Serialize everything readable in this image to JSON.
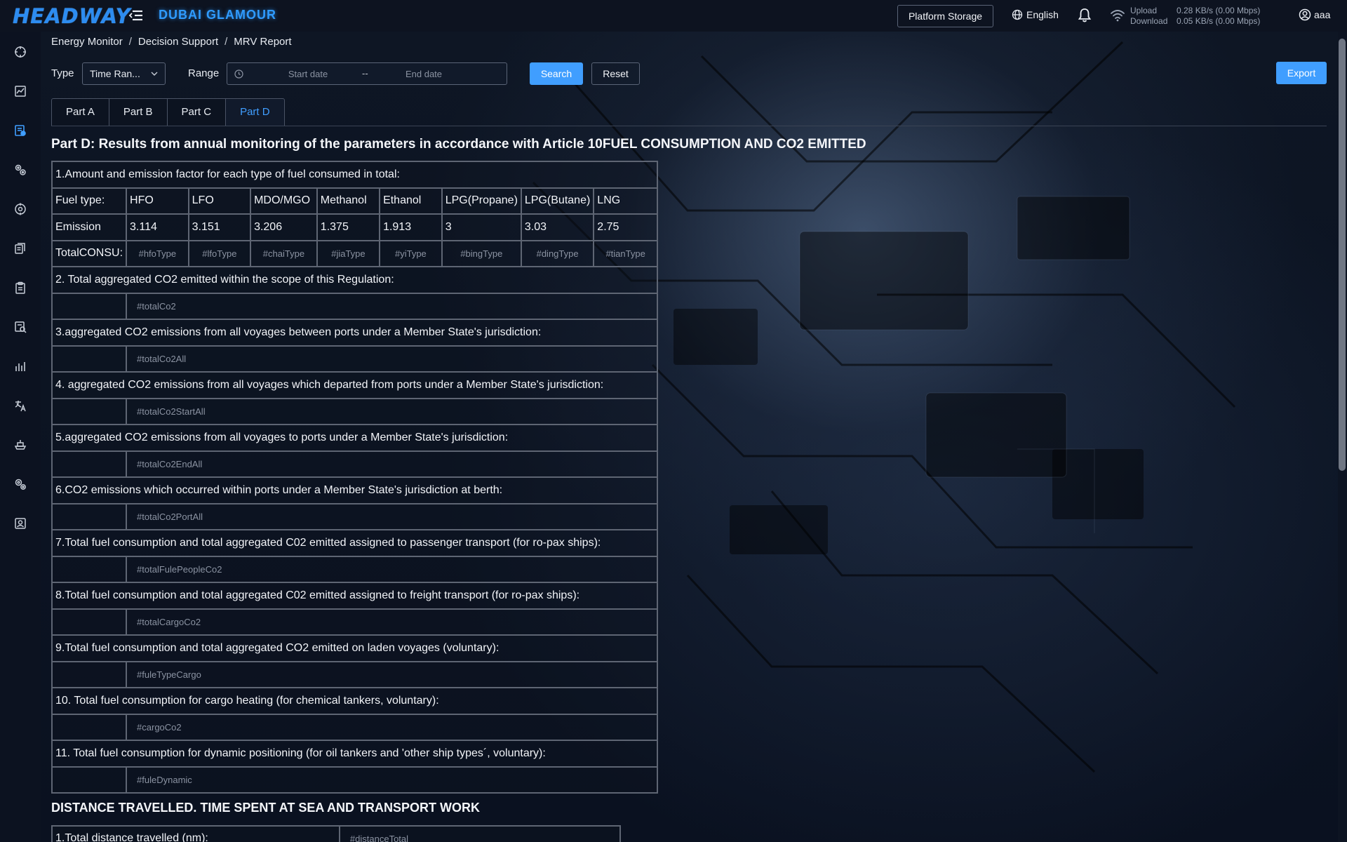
{
  "header": {
    "logo_text": "HEADWAY",
    "ship_name": "DUBAI GLAMOUR",
    "storage_label": "Platform Storage",
    "language": "English",
    "network": {
      "upload_label": "Upload",
      "download_label": "Download",
      "upload_value": "0.28 KB/s (0.00 Mbps)",
      "download_value": "0.05 KB/s (0.00 Mbps)"
    },
    "user_name": "aaa"
  },
  "sidebar": {
    "items": [
      {
        "icon": "crosshair-icon"
      },
      {
        "icon": "chart-icon"
      },
      {
        "icon": "report-icon",
        "active": true
      },
      {
        "icon": "gears-icon"
      },
      {
        "icon": "target-icon"
      },
      {
        "icon": "documents-icon"
      },
      {
        "icon": "clipboard-icon"
      },
      {
        "icon": "analysis-icon"
      },
      {
        "icon": "bar-chart-icon"
      },
      {
        "icon": "translate-icon"
      },
      {
        "icon": "ship-icon"
      },
      {
        "icon": "settings-icon"
      },
      {
        "icon": "user-card-icon"
      }
    ]
  },
  "breadcrumb": [
    "Energy Monitor",
    "Decision Support",
    "MRV Report"
  ],
  "breadcrumb_separator": "/",
  "filters": {
    "type_label": "Type",
    "type_value": "Time Ran...",
    "range_label": "Range",
    "start_placeholder": "Start date",
    "end_placeholder": "End date",
    "range_separator": "--",
    "search_label": "Search",
    "reset_label": "Reset",
    "export_label": "Export"
  },
  "tabs": [
    {
      "label": "Part A",
      "active": false
    },
    {
      "label": "Part B",
      "active": false
    },
    {
      "label": "Part C",
      "active": false
    },
    {
      "label": "Part D",
      "active": true
    }
  ],
  "part_title": "Part D: Results from annual monitoring of the parameters in accordance with Article 10FUEL CONSUMPTION AND CO2 EMITTED",
  "fuel_table": {
    "heading": "1.Amount and emission factor for each type of fuel consumed in total:",
    "fuel_type_label": "Fuel type:",
    "fuel_types": [
      "HFO",
      "LFO",
      "MDO/MGO",
      "Methanol",
      "Ethanol",
      "LPG(Propane)",
      "LPG(Butane)",
      "LNG"
    ],
    "emission_label": "Emission",
    "emission_values": [
      "3.114",
      "3.151",
      "3.206",
      "1.375",
      "1.913",
      "3",
      "3.03",
      "2.75"
    ],
    "total_label": "TotalCONSU:",
    "total_placeholders": [
      "#hfoType",
      "#lfoType",
      "#chaiType",
      "#jiaType",
      "#yiType",
      "#bingType",
      "#dingType",
      "#tianType"
    ]
  },
  "items": [
    {
      "label": "2. Total aggregated CO2 emitted within the scope of this Regulation:",
      "placeholder": "#totalCo2"
    },
    {
      "label": "3.aggregated CO2 emissions from all voyages between ports under a Member State's jurisdiction:",
      "placeholder": "#totalCo2All"
    },
    {
      "label": "4. aggregated CO2 emissions from all voyages which departed from ports under a Member State's jurisdiction:",
      "placeholder": "#totalCo2StartAll"
    },
    {
      "label": "5.aggregated CO2 emissions from all voyages to ports under a Member State's jurisdiction:",
      "placeholder": "#totalCo2EndAll"
    },
    {
      "label": "6.CO2 emissions which occurred within ports under a Member State's jurisdiction at berth:",
      "placeholder": "#totalCo2PortAll"
    },
    {
      "label": "7.Total fuel consumption and total aggregated C02 emitted assigned to passenger transport (for ro-pax ships):",
      "placeholder": "#totalFulePeopleCo2"
    },
    {
      "label": "8.Total fuel consumption and total aggregated C02 emitted assigned to freight transport (for ro-pax ships):",
      "placeholder": "#totalCargoCo2"
    },
    {
      "label": "9.Total fuel consumption and total aggregated CO2 emitted on laden voyages (voluntary):",
      "placeholder": "#fuleTypeCargo"
    },
    {
      "label": "10. Total fuel consumption for cargo heating (for chemical tankers, voluntary):",
      "placeholder": "#cargoCo2"
    },
    {
      "label": "11. Total fuel consumption for dynamic positioning (for oil tankers and 'other ship types´, voluntary):",
      "placeholder": "#fuleDynamic"
    }
  ],
  "distance_section": {
    "title": "DISTANCE TRAVELLED. TIME SPENT AT SEA AND TRANSPORT WORK",
    "rows": [
      {
        "label": "1.Total distance travelled (nm):",
        "placeholder": "#distanceTotal"
      }
    ]
  },
  "colors": {
    "accent": "#409eff",
    "ship_name": "#2f9bff",
    "background": "#0b1220"
  }
}
